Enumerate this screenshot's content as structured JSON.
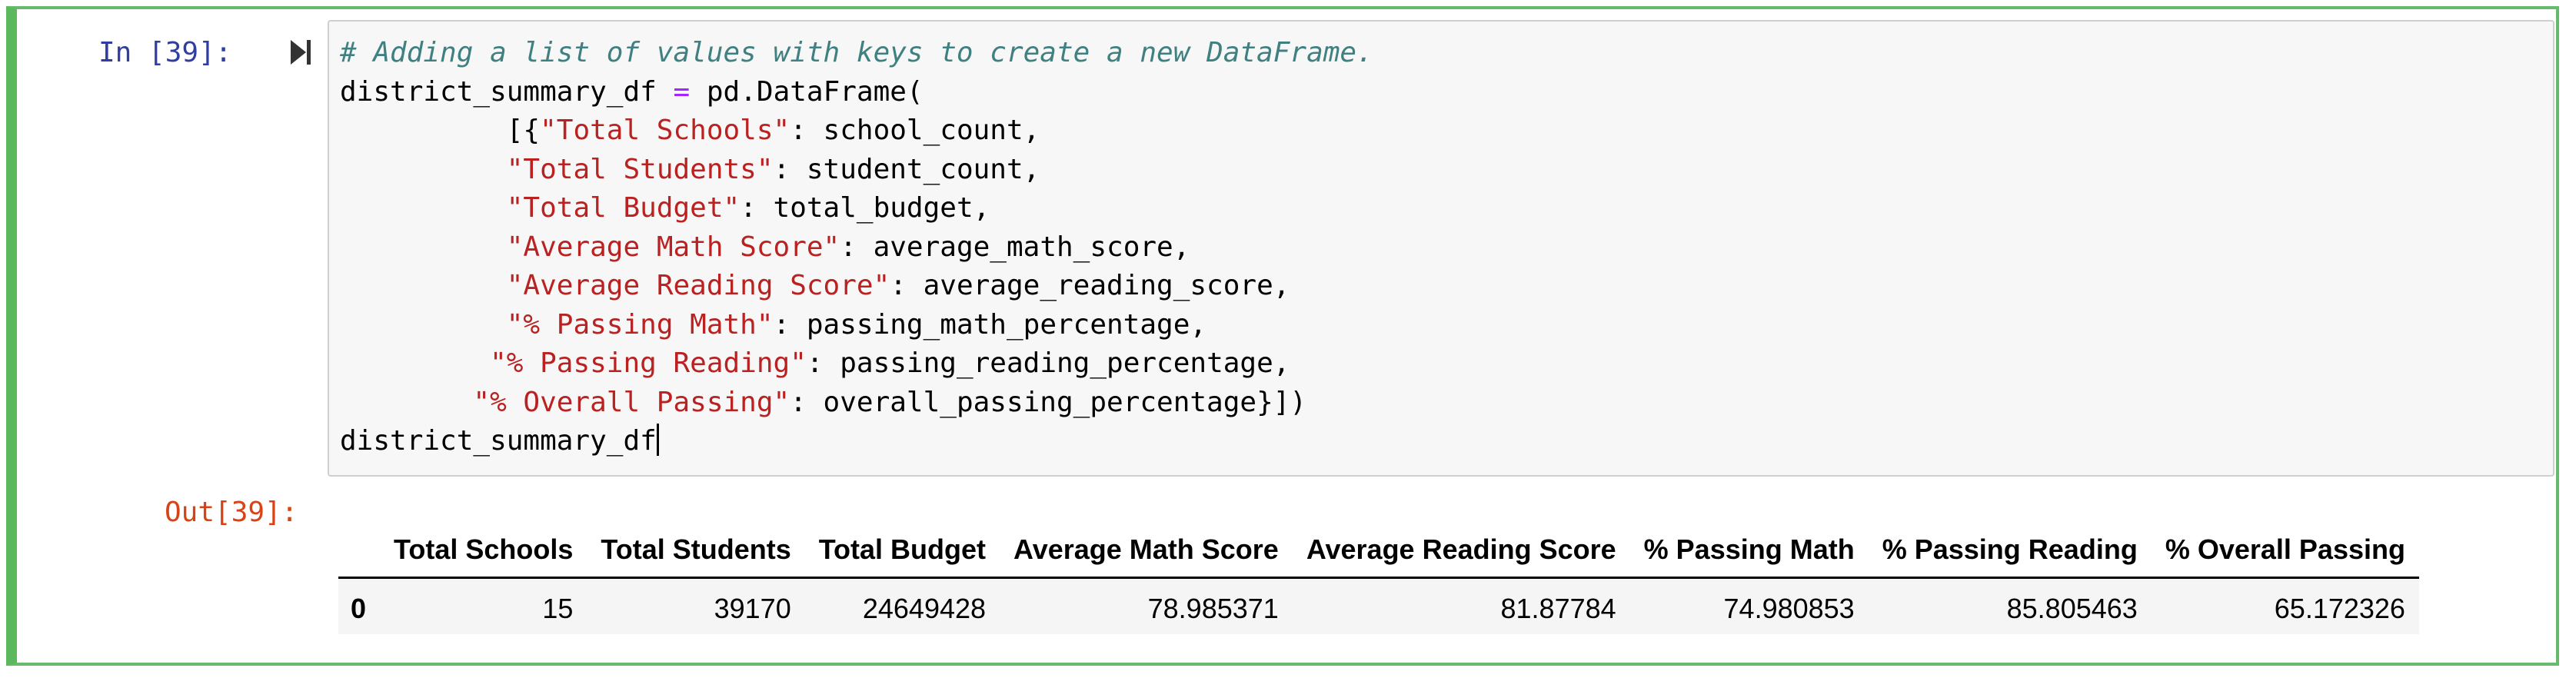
{
  "cell": {
    "in_prompt": "In [39]:",
    "out_prompt": "Out[39]:",
    "run_icon": "run-cell-icon"
  },
  "code": {
    "comment": "# Adding a list of values with keys to create a new DataFrame.",
    "lines": [
      {
        "var": "district_summary_df",
        "eq": "=",
        "call": "pd.DataFrame("
      },
      {
        "indent": "          [{",
        "key": "\"Total Schools\"",
        "rest": ": school_count,"
      },
      {
        "indent": "          ",
        "key": "\"Total Students\"",
        "rest": ": student_count,"
      },
      {
        "indent": "          ",
        "key": "\"Total Budget\"",
        "rest": ": total_budget,"
      },
      {
        "indent": "          ",
        "key": "\"Average Math Score\"",
        "rest": ": average_math_score,"
      },
      {
        "indent": "          ",
        "key": "\"Average Reading Score\"",
        "rest": ": average_reading_score,"
      },
      {
        "indent": "          ",
        "key": "\"% Passing Math\"",
        "rest": ": passing_math_percentage,"
      },
      {
        "indent": "         ",
        "key": "\"% Passing Reading\"",
        "rest": ": passing_reading_percentage,"
      },
      {
        "indent": "        ",
        "key": "\"% Overall Passing\"",
        "rest": ": overall_passing_percentage}])"
      }
    ],
    "last_line": "district_summary_df"
  },
  "output": {
    "columns": [
      "Total Schools",
      "Total Students",
      "Total Budget",
      "Average Math Score",
      "Average Reading Score",
      "% Passing Math",
      "% Passing Reading",
      "% Overall Passing"
    ],
    "rows": [
      {
        "index": "0",
        "values": [
          "15",
          "39170",
          "24649428",
          "78.985371",
          "81.87784",
          "74.980853",
          "85.805463",
          "65.172326"
        ]
      }
    ]
  },
  "colors": {
    "selected_border": "#5cb85c",
    "in_prompt": "#303f9f",
    "out_prompt": "#d84315",
    "comment": "#408080",
    "string": "#ba2121",
    "operator": "#aa22ff"
  }
}
